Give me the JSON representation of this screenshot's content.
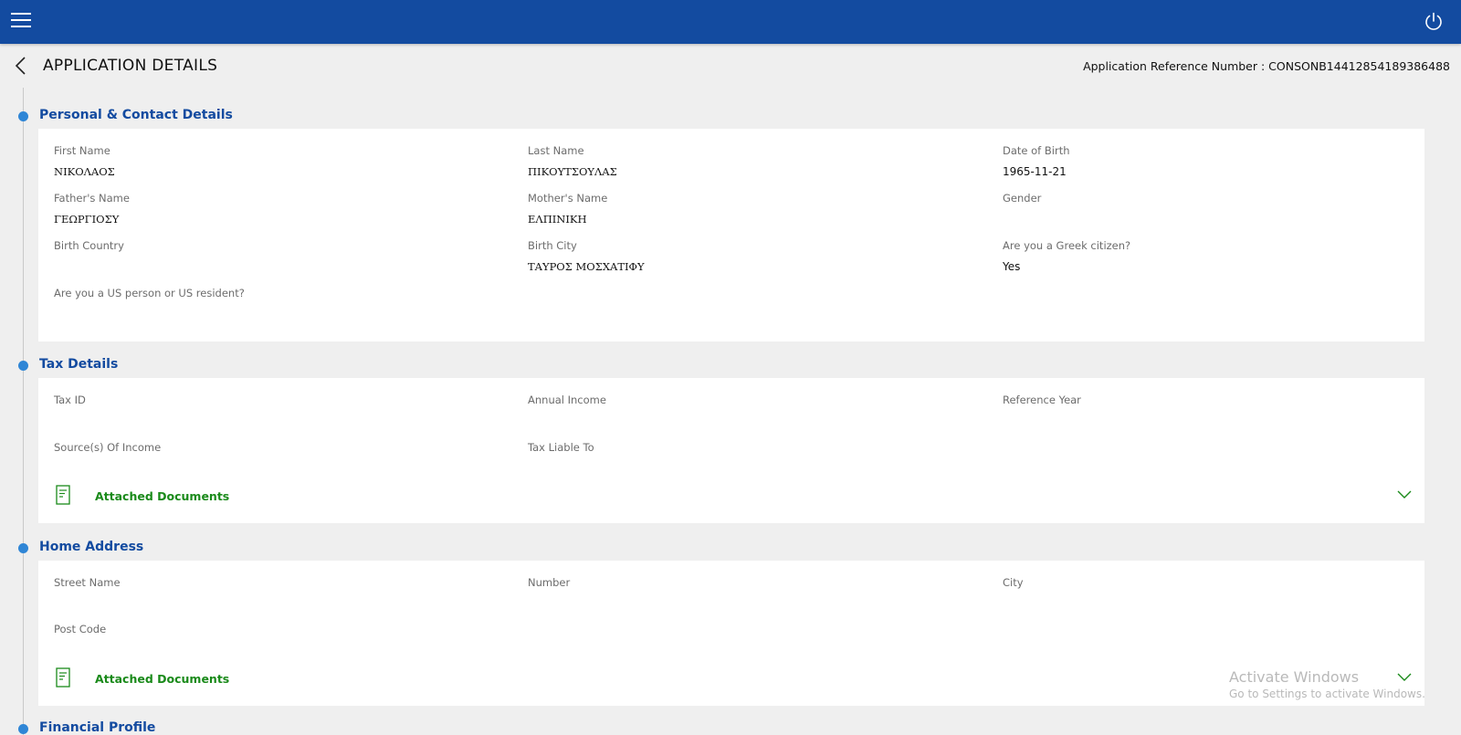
{
  "header": {
    "menu_icon": "hamburger-menu-icon",
    "power_icon": "power-icon",
    "color": "#134ba0"
  },
  "page": {
    "title": "APPLICATION DETAILS",
    "reference_label": "Application Reference Number : CONSONB14412854189386488"
  },
  "sections": {
    "personal": {
      "title": "Personal & Contact Details",
      "first_name_label": "First Name",
      "first_name_value": "ΝΙΚΟΛΑΟΣ",
      "last_name_label": "Last Name",
      "last_name_value": "ΠΙΚΟΥΤΣΟΥΛΑΣ",
      "dob_label": "Date of Birth",
      "dob_value": "1965-11-21",
      "father_label": "Father's Name",
      "father_value": "ΓΕΩΡΓΙΟΣΥ",
      "mother_label": "Mother's Name",
      "mother_value": "ΕΛΠΙΝΙΚΗ",
      "gender_label": "Gender",
      "birth_country_label": "Birth Country",
      "birth_city_label": "Birth City",
      "birth_city_value": "ΤΑΥΡΟΣ ΜΟΣΧΑΤΙΦΥ",
      "greek_citizen_label": "Are you a Greek citizen?",
      "greek_citizen_value": "Yes",
      "us_person_label": "Are you a US person or US resident?"
    },
    "tax": {
      "title": "Tax Details",
      "tax_id_label": "Tax ID",
      "annual_income_label": "Annual Income",
      "reference_year_label": "Reference Year",
      "source_income_label": "Source(s) Of Income",
      "tax_liable_label": "Tax Liable To",
      "attached_docs_label": "Attached Documents"
    },
    "home": {
      "title": "Home Address",
      "street_label": "Street Name",
      "number_label": "Number",
      "city_label": "City",
      "post_code_label": "Post Code",
      "attached_docs_label": "Attached Documents"
    },
    "financial": {
      "title": "Financial Profile"
    }
  },
  "watermark": {
    "line1": "Activate Windows",
    "line2": "Go to Settings to activate Windows."
  },
  "colors": {
    "accent_blue": "#134ba0",
    "timeline_dot": "#2f86d6",
    "docs_green": "#1a8a1a"
  }
}
